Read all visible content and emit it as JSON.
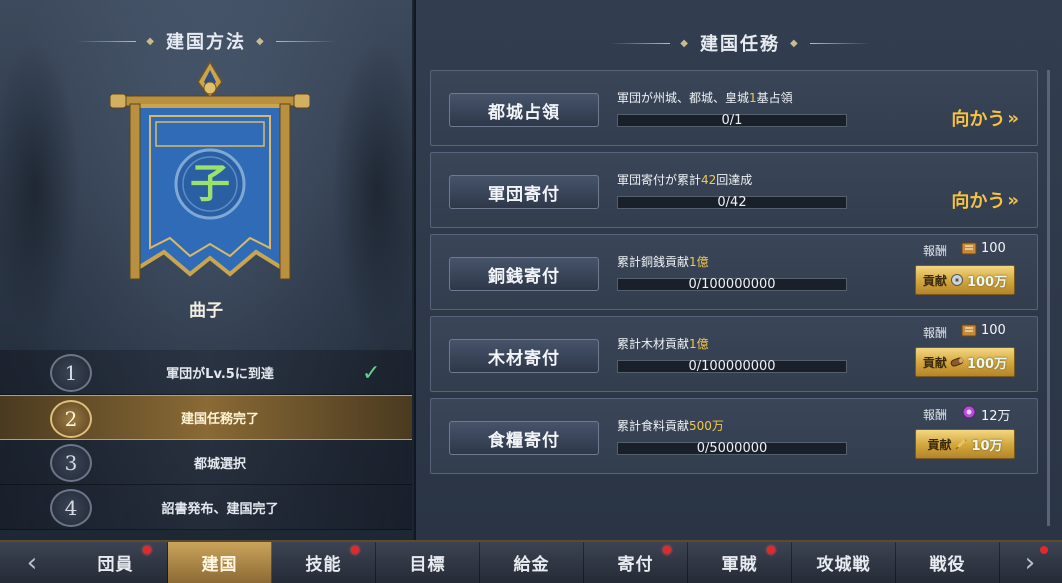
{
  "left": {
    "title": "建国方法",
    "banner_char": "子",
    "banner_name": "曲子",
    "steps": [
      {
        "num": "1",
        "label": "軍団がLv.5に到達",
        "done": true
      },
      {
        "num": "2",
        "label": "建国任務完了",
        "active": true
      },
      {
        "num": "3",
        "label": "都城選択"
      },
      {
        "num": "4",
        "label": "詔書発布、建国完了"
      }
    ]
  },
  "right": {
    "title": "建国任務",
    "tasks": [
      {
        "name": "都城占領",
        "desc_pre": "軍団が州城、都城、皇城",
        "desc_hl": "1",
        "desc_post": "基占領",
        "progress": "0/1",
        "action": "向かう"
      },
      {
        "name": "軍団寄付",
        "desc_pre": "軍団寄付が累計",
        "desc_hl": "42",
        "desc_post": "回達成",
        "progress": "0/42",
        "action": "向かう"
      },
      {
        "name": "銅銭寄付",
        "desc_pre": "累計銅銭貢献",
        "desc_hl": "1億",
        "desc_post": "",
        "progress": "0/100000000",
        "reward_label": "報酬",
        "reward_icon": "contribution-icon",
        "reward_value": "100",
        "contrib_label": "貢献",
        "contrib_icon": "coin-icon",
        "contrib_value": "100万"
      },
      {
        "name": "木材寄付",
        "desc_pre": "累計木材貢献",
        "desc_hl": "1億",
        "desc_post": "",
        "progress": "0/100000000",
        "reward_label": "報酬",
        "reward_icon": "contribution-icon",
        "reward_value": "100",
        "contrib_label": "貢献",
        "contrib_icon": "wood-icon",
        "contrib_value": "100万"
      },
      {
        "name": "食糧寄付",
        "desc_pre": "累計食料貢献",
        "desc_hl": "500万",
        "desc_post": "",
        "progress": "0/5000000",
        "reward_label": "報酬",
        "reward_icon": "orb-icon",
        "reward_value": "12万",
        "contrib_label": "貢献",
        "contrib_icon": "grain-icon",
        "contrib_value": "10万"
      }
    ]
  },
  "tabs": [
    {
      "label": "団員",
      "dot": true
    },
    {
      "label": "建国",
      "selected": true
    },
    {
      "label": "技能",
      "dot": true
    },
    {
      "label": "目標"
    },
    {
      "label": "給金"
    },
    {
      "label": "寄付",
      "dot": true
    },
    {
      "label": "軍賊",
      "dot": true
    },
    {
      "label": "攻城戦"
    },
    {
      "label": "戦役"
    }
  ],
  "colors": {
    "accent_gold": "#f5c242",
    "highlight_yellow": "#f2c94c",
    "check_green": "#66d08a",
    "notify_red": "#e02a2a"
  }
}
